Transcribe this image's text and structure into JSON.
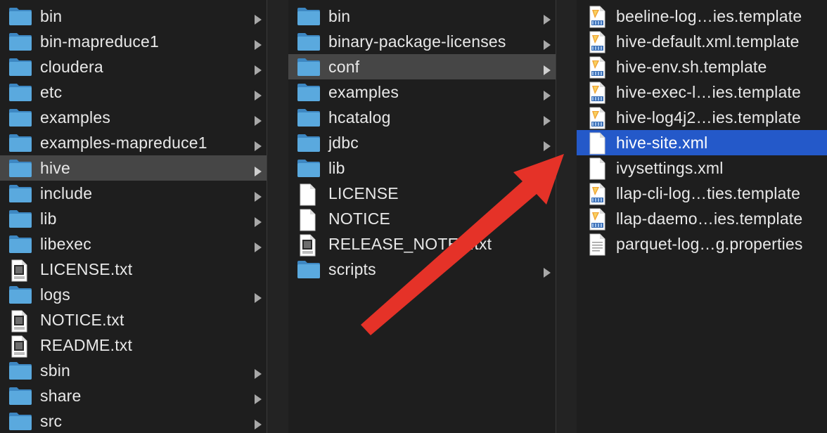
{
  "columns": [
    {
      "items": [
        {
          "name": "bin",
          "kind": "folder",
          "chevron": true
        },
        {
          "name": "bin-mapreduce1",
          "kind": "folder",
          "chevron": true
        },
        {
          "name": "cloudera",
          "kind": "folder",
          "chevron": true
        },
        {
          "name": "etc",
          "kind": "folder",
          "chevron": true
        },
        {
          "name": "examples",
          "kind": "folder",
          "chevron": true
        },
        {
          "name": "examples-mapreduce1",
          "kind": "folder",
          "chevron": true
        },
        {
          "name": "hive",
          "kind": "folder",
          "chevron": true,
          "selected": "gray"
        },
        {
          "name": "include",
          "kind": "folder",
          "chevron": true
        },
        {
          "name": "lib",
          "kind": "folder",
          "chevron": true
        },
        {
          "name": "libexec",
          "kind": "folder",
          "chevron": true
        },
        {
          "name": "LICENSE.txt",
          "kind": "text-file",
          "chevron": false
        },
        {
          "name": "logs",
          "kind": "folder",
          "chevron": true
        },
        {
          "name": "NOTICE.txt",
          "kind": "text-file",
          "chevron": false
        },
        {
          "name": "README.txt",
          "kind": "text-file",
          "chevron": false
        },
        {
          "name": "sbin",
          "kind": "folder",
          "chevron": true
        },
        {
          "name": "share",
          "kind": "folder",
          "chevron": true
        },
        {
          "name": "src",
          "kind": "folder",
          "chevron": true
        }
      ]
    },
    {
      "items": [
        {
          "name": "bin",
          "kind": "folder",
          "chevron": true
        },
        {
          "name": "binary-package-licenses",
          "kind": "folder",
          "chevron": true
        },
        {
          "name": "conf",
          "kind": "folder",
          "chevron": true,
          "selected": "gray"
        },
        {
          "name": "examples",
          "kind": "folder",
          "chevron": true
        },
        {
          "name": "hcatalog",
          "kind": "folder",
          "chevron": true
        },
        {
          "name": "jdbc",
          "kind": "folder",
          "chevron": true
        },
        {
          "name": "lib",
          "kind": "folder",
          "chevron": true
        },
        {
          "name": "LICENSE",
          "kind": "blank-file",
          "chevron": false
        },
        {
          "name": "NOTICE",
          "kind": "blank-file",
          "chevron": false
        },
        {
          "name": "RELEASE_NOTES.txt",
          "kind": "text-file",
          "chevron": false
        },
        {
          "name": "scripts",
          "kind": "folder",
          "chevron": true
        }
      ]
    },
    {
      "items": [
        {
          "name": "beeline-log…ies.template",
          "kind": "template-file",
          "chevron": false
        },
        {
          "name": "hive-default.xml.template",
          "kind": "template-file",
          "chevron": false
        },
        {
          "name": "hive-env.sh.template",
          "kind": "template-file",
          "chevron": false
        },
        {
          "name": "hive-exec-l…ies.template",
          "kind": "template-file",
          "chevron": false
        },
        {
          "name": "hive-log4j2…ies.template",
          "kind": "template-file",
          "chevron": false
        },
        {
          "name": "hive-site.xml",
          "kind": "blank-file",
          "chevron": false,
          "selected": "blue"
        },
        {
          "name": "ivysettings.xml",
          "kind": "blank-file",
          "chevron": false
        },
        {
          "name": "llap-cli-log…ties.template",
          "kind": "template-file",
          "chevron": false
        },
        {
          "name": "llap-daemo…ies.template",
          "kind": "template-file",
          "chevron": false
        },
        {
          "name": "parquet-log…g.properties",
          "kind": "lines-file",
          "chevron": false
        }
      ]
    }
  ],
  "colors": {
    "background": "#1e1e1e",
    "selected_gray": "#464646",
    "selected_blue": "#2459c9",
    "folder": "#5aa9de",
    "arrow": "#e53228"
  }
}
